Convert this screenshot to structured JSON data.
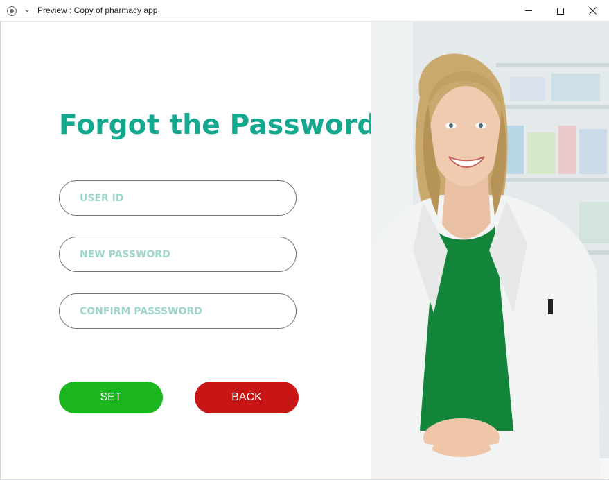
{
  "window": {
    "title": "Preview : Copy of pharmacy app",
    "icons": [
      "app-icon",
      "chevron-down-icon",
      "minimize-icon",
      "maximize-icon",
      "close-icon"
    ]
  },
  "form": {
    "heading": "Forgot the Password",
    "user_id_placeholder": "USER ID",
    "new_password_placeholder": "NEW PASSWORD",
    "confirm_password_placeholder": "CONFIRM PASSSWORD",
    "set_label": "SET",
    "back_label": "BACK"
  },
  "colors": {
    "heading": "#14a88f",
    "placeholder": "#9fd6cc",
    "set_button": "#1bb51e",
    "back_button": "#c81616"
  }
}
